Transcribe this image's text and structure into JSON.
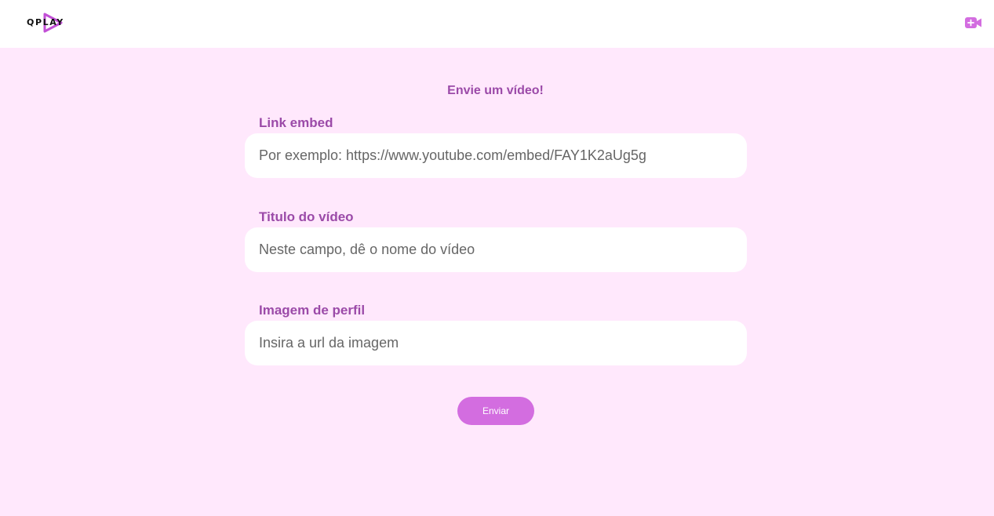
{
  "header": {
    "logo_text": "QPLAY",
    "add_video_icon": "video-plus-icon",
    "accent_color": "#d36de0"
  },
  "form": {
    "title": "Envie um vídeo!",
    "fields": [
      {
        "label": "Link embed",
        "value": "",
        "placeholder": "Por exemplo: https://www.youtube.com/embed/FAY1K2aUg5g"
      },
      {
        "label": "Titulo do vídeo",
        "value": "",
        "placeholder": "Neste campo, dê o nome do vídeo"
      },
      {
        "label": "Imagem de perfil",
        "value": "",
        "placeholder": "Insira a url da imagem"
      }
    ],
    "submit_label": "Enviar"
  },
  "colors": {
    "background": "#ffe8fc",
    "label": "#9b4aa8",
    "button": "#d36de0",
    "topbar": "#ffffff"
  }
}
